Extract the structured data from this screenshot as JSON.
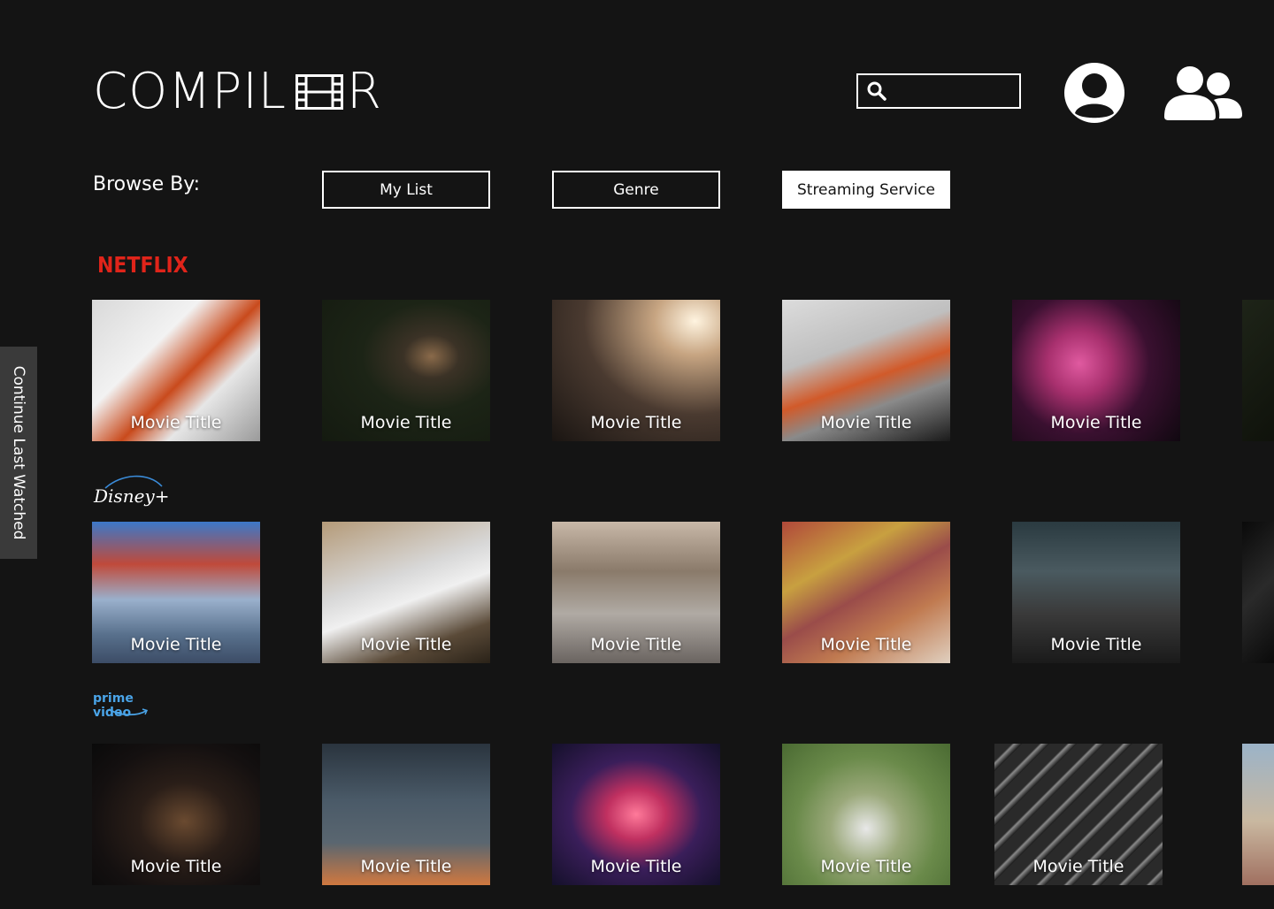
{
  "header": {
    "logo_text_left": "COMPIL",
    "logo_text_right": "R",
    "logo_icon": "film-strip-icon",
    "search_placeholder": "",
    "profile_icon": "user-circle-icon",
    "users_icon": "users-icon"
  },
  "browse": {
    "label": "Browse By:",
    "options": [
      "My List",
      "Genre",
      "Streaming Service"
    ],
    "active": "Streaming Service"
  },
  "side_tab": {
    "label": "Continue Last Watched"
  },
  "colors": {
    "background": "#141414",
    "netflix_red": "#e0241a",
    "disney_arc": "#3a8bd8",
    "prime_blue": "#4aa4e8",
    "side_tab": "#3a3a3a"
  },
  "rows": [
    {
      "service": "NETFLIX",
      "tiles": [
        {
          "title": "Movie Title",
          "image": "sneaker-photo"
        },
        {
          "title": "Movie Title",
          "image": "aerial-forest-photo"
        },
        {
          "title": "Movie Title",
          "image": "car-dashboard-photo"
        },
        {
          "title": "Movie Title",
          "image": "sneaker-steering-wheel-photo"
        },
        {
          "title": "Movie Title",
          "image": "pink-blossom-photo"
        }
      ]
    },
    {
      "service": "Disney+",
      "tiles": [
        {
          "title": "Movie Title",
          "image": "scooter-motion-photo"
        },
        {
          "title": "Movie Title",
          "image": "skyscraper-photo"
        },
        {
          "title": "Movie Title",
          "image": "street-couple-photo"
        },
        {
          "title": "Movie Title",
          "image": "painted-hills-photo"
        },
        {
          "title": "Movie Title",
          "image": "temple-people-photo"
        }
      ]
    },
    {
      "service": "prime video",
      "tiles": [
        {
          "title": "Movie Title",
          "image": "car-mirror-photo"
        },
        {
          "title": "Movie Title",
          "image": "clouds-sunset-photo"
        },
        {
          "title": "Movie Title",
          "image": "tokyo-neon-sign-photo"
        },
        {
          "title": "Movie Title",
          "image": "jordan-sneakers-grass-photo"
        },
        {
          "title": "Movie Title",
          "image": "building-facade-photo"
        }
      ]
    }
  ]
}
